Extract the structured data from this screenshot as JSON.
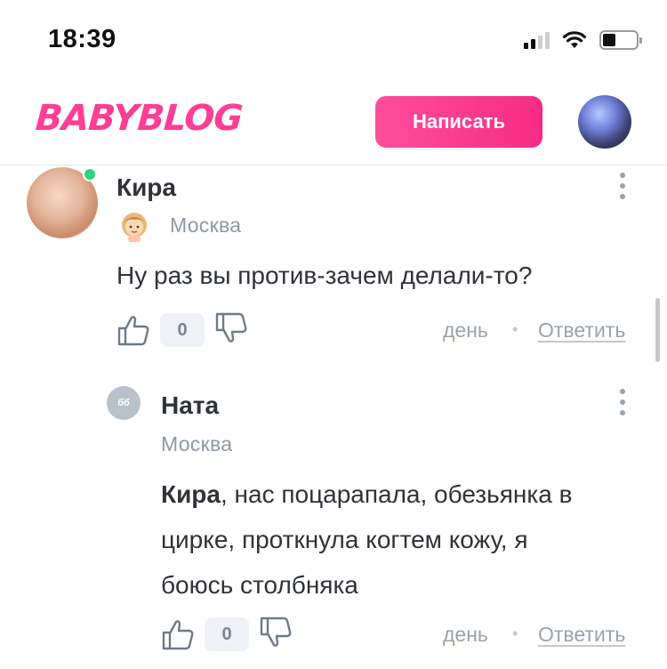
{
  "status_bar": {
    "time": "18:39"
  },
  "header": {
    "logo": "BABYBLOG",
    "write_button": "Написать"
  },
  "comments": [
    {
      "author": "Кира",
      "city": "Москва",
      "text": "Ну раз вы против-зачем делали-то?",
      "likes": "0",
      "time": "день",
      "reply": "Ответить",
      "online": true
    },
    {
      "author": "Ната",
      "avatar_initials": "бб",
      "city": "Москва",
      "mention": "Кира",
      "text_line1_rest": ", нас поцарапала, обезьянка в",
      "text_line2": "цирке, проткнула когтем кожу, я",
      "text_line3": "боюсь столбняка",
      "likes": "0",
      "time": "день",
      "reply": "Ответить"
    }
  ],
  "colors": {
    "brand_pink": "#ff3e96",
    "online_green": "#2fd47b",
    "muted_text": "#9aa3ad"
  },
  "icons": [
    "wifi-icon",
    "signal-icon",
    "battery-icon",
    "thumbs-up-icon",
    "thumbs-down-icon",
    "more-vertical-icon",
    "rank-badge-icon"
  ]
}
